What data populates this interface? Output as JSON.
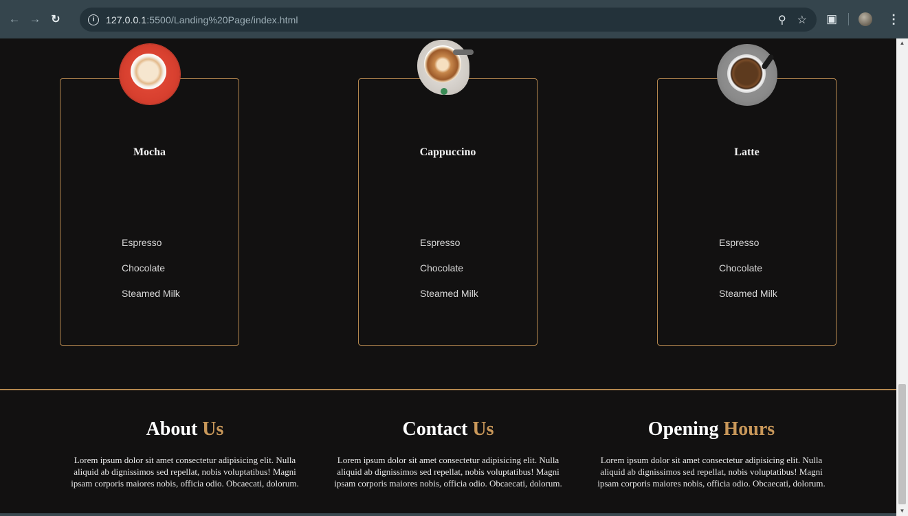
{
  "browser": {
    "url_host": "127.0.0.1",
    "url_path": ":5500/Landing%20Page/index.html",
    "icons": [
      "back-arrow-icon",
      "forward-arrow-icon",
      "reload-icon",
      "info-icon",
      "zoom-icon",
      "star-icon",
      "extensions-icon",
      "profile-avatar",
      "kebab-menu-icon"
    ]
  },
  "products": [
    {
      "name": "Mocha",
      "ingredients": [
        "Espresso",
        "Chocolate",
        "Steamed Milk"
      ]
    },
    {
      "name": "Cappuccino",
      "ingredients": [
        "Espresso",
        "Chocolate",
        "Steamed Milk"
      ]
    },
    {
      "name": "Latte",
      "ingredients": [
        "Espresso",
        "Chocolate",
        "Steamed Milk"
      ]
    }
  ],
  "footer": {
    "about": {
      "title_main": "About",
      "title_accent": "Us",
      "text": "Lorem ipsum dolor sit amet consectetur adipisicing elit. Nulla aliquid ab dignissimos sed repellat, nobis voluptatibus! Magni ipsam corporis maiores nobis, officia odio. Obcaecati, dolorum."
    },
    "contact": {
      "title_main": "Contact",
      "title_accent": "Us",
      "text": "Lorem ipsum dolor sit amet consectetur adipisicing elit. Nulla aliquid ab dignissimos sed repellat, nobis voluptatibus! Magni ipsam corporis maiores nobis, officia odio. Obcaecati, dolorum."
    },
    "hours": {
      "title_main": "Opening",
      "title_accent": "Hours",
      "text": "Lorem ipsum dolor sit amet consectetur adipisicing elit. Nulla aliquid ab dignissimos sed repellat, nobis voluptatibus! Magni ipsam corporis maiores nobis, officia odio. Obcaecati, dolorum."
    }
  },
  "colors": {
    "accent": "#c9985a",
    "card_border": "#b4874f",
    "background": "#121111",
    "chrome": "#35454d"
  }
}
